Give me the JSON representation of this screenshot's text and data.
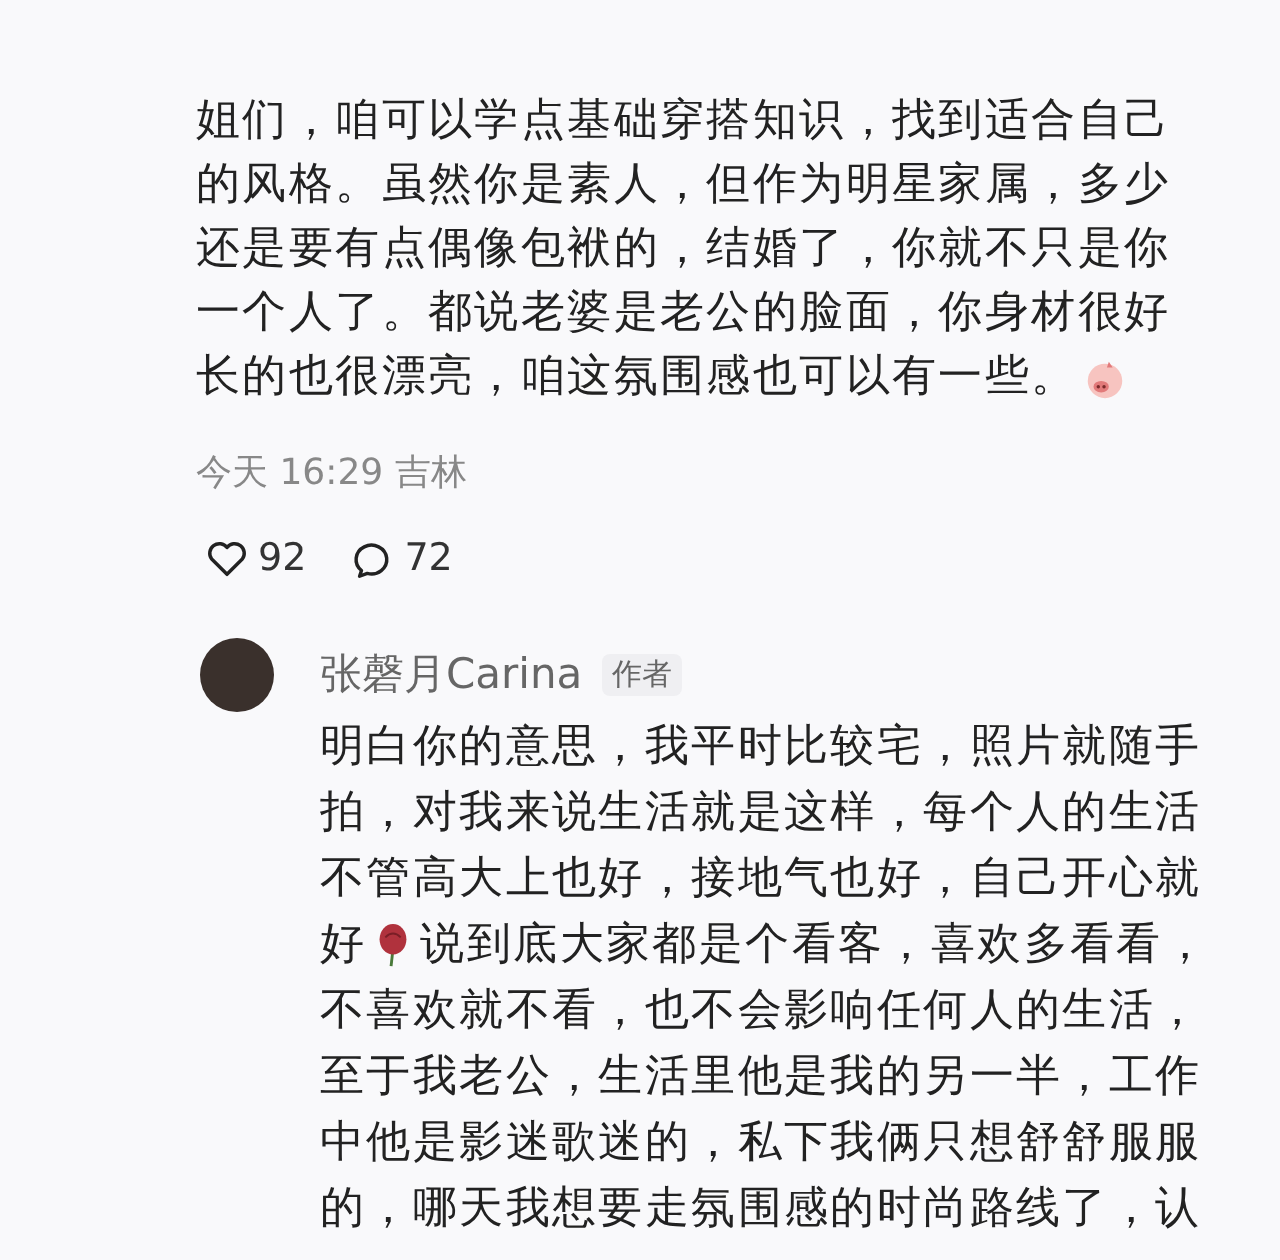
{
  "comment": {
    "lines": [
      [
        {
          "kind": "text",
          "text": "姐们，咱可以学点基础穿搭知识，找到适合自己"
        }
      ],
      [
        {
          "kind": "text",
          "text": "的风格。虽然你是素人，但作为明星家属，多少"
        }
      ],
      [
        {
          "kind": "text",
          "text": "还是要有点偶像包袱的，结婚了，你就不只是你"
        }
      ],
      [
        {
          "kind": "text",
          "text": "一个人了。都说老婆是老公的脸面，你身材很好"
        }
      ],
      [
        {
          "kind": "text",
          "text": "长的也很漂亮，咱这氛围感也可以有一些。"
        },
        {
          "kind": "pig"
        }
      ]
    ],
    "meta": "今天 16:29 吉林",
    "likes": "92",
    "replies_count": "72"
  },
  "reply": {
    "author": "张磬月Carina",
    "badge": "作者",
    "lines": [
      [
        {
          "kind": "text",
          "text": "明白你的意思，我平时比较宅，照片就随手"
        }
      ],
      [
        {
          "kind": "text",
          "text": "拍，对我来说生活就是这样，每个人的生活"
        }
      ],
      [
        {
          "kind": "text",
          "text": "不管高大上也好，接地气也好，自己开心就"
        }
      ],
      [
        {
          "kind": "text",
          "text": "好"
        },
        {
          "kind": "rose"
        },
        {
          "kind": "text",
          "text": "说到底大家都是个看客，喜欢多看看，"
        }
      ],
      [
        {
          "kind": "text",
          "text": "不喜欢就不看，也不会影响任何人的生活，"
        }
      ],
      [
        {
          "kind": "text",
          "text": "至于我老公，生活里他是我的另一半，工作"
        }
      ],
      [
        {
          "kind": "text",
          "text": "中他是影迷歌迷的，私下我俩只想舒舒服服"
        }
      ],
      [
        {
          "kind": "text",
          "text": "的，哪天我想要走氛围感的时尚路线了，认"
        }
      ]
    ]
  }
}
